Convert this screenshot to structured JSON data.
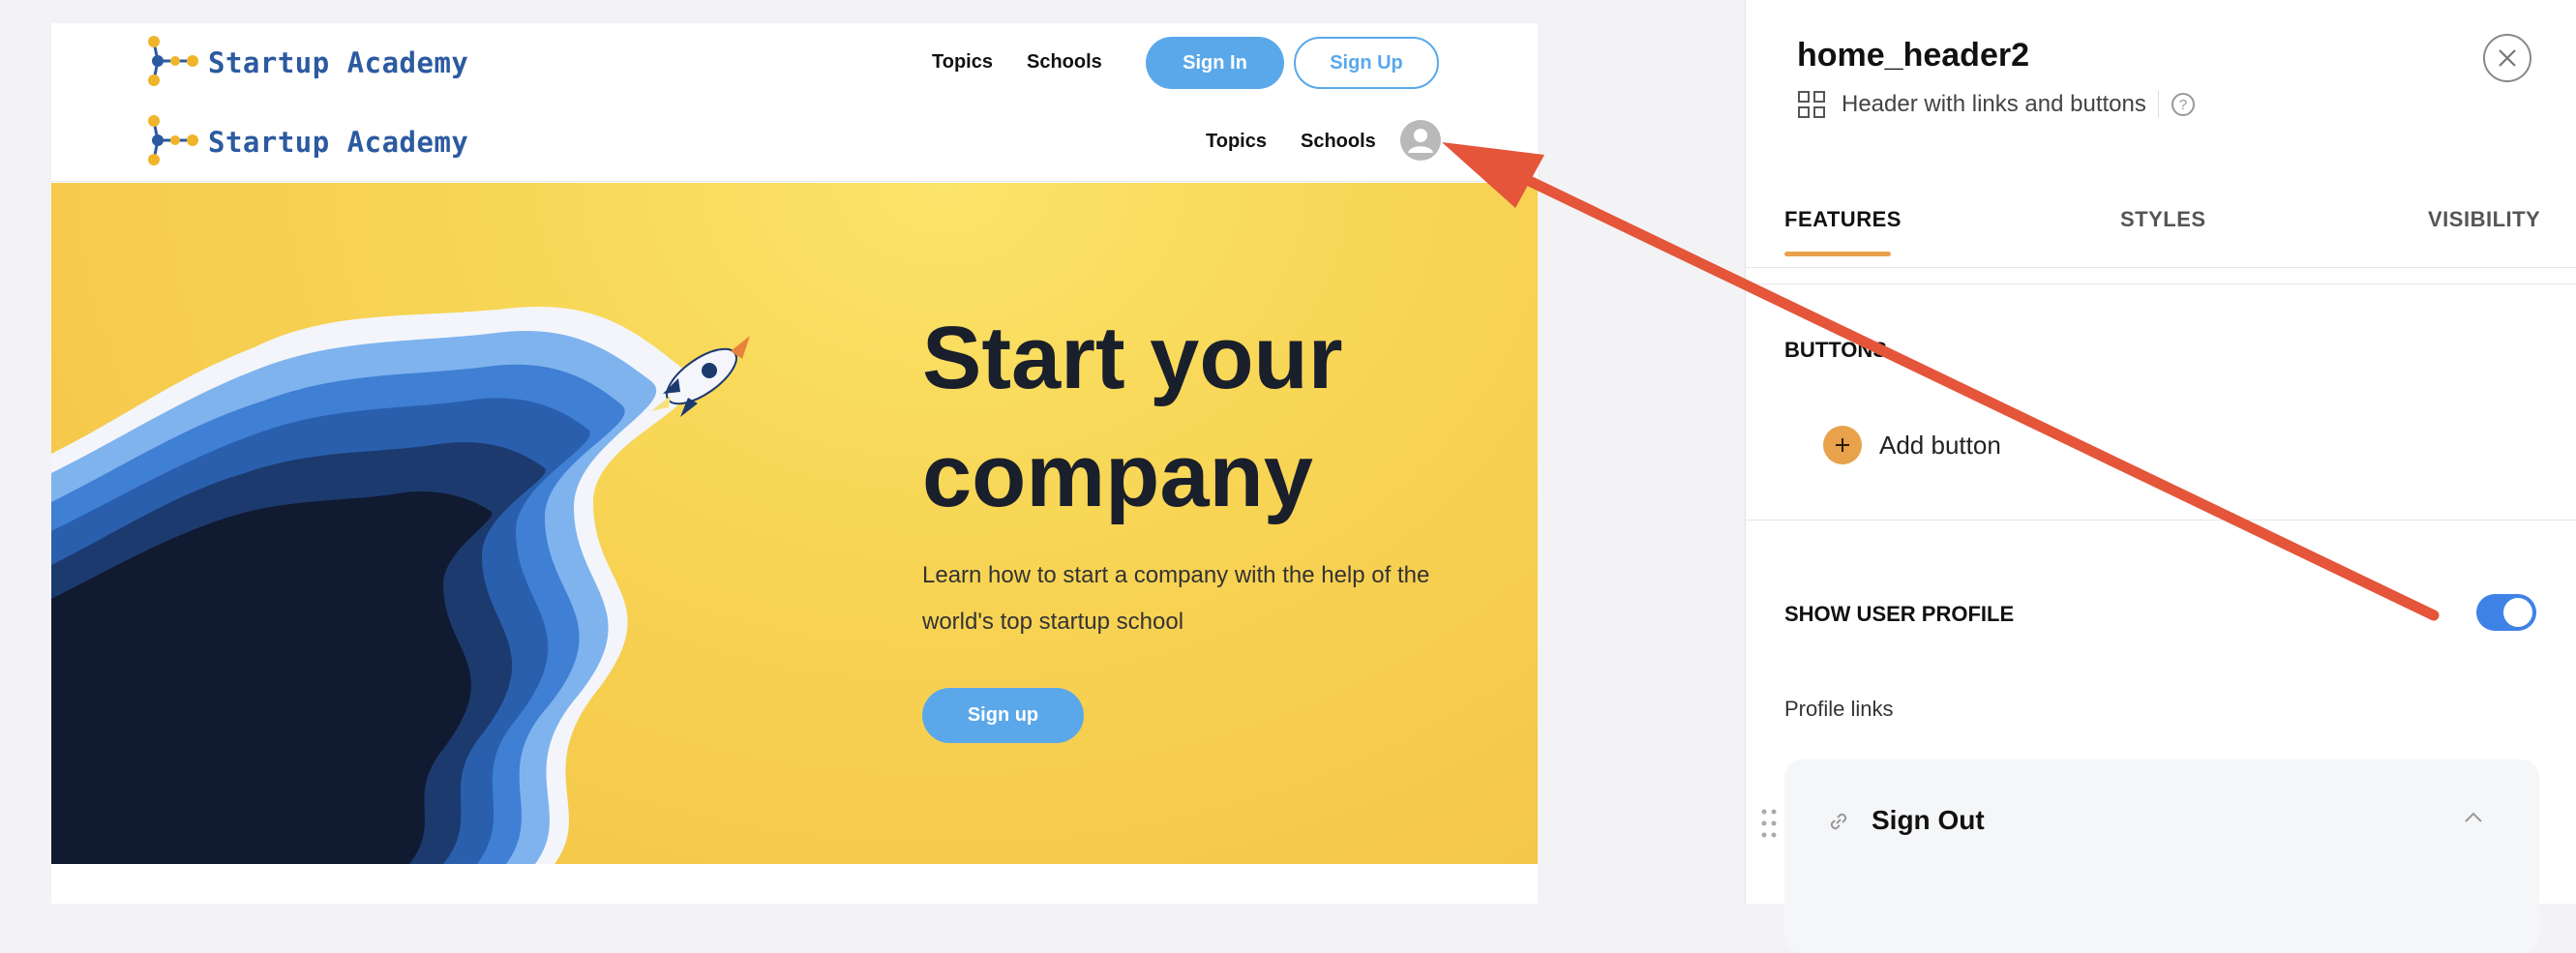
{
  "preview": {
    "brand": "Startup Academy",
    "header1": {
      "nav": [
        "Topics",
        "Schools"
      ],
      "signin_label": "Sign In",
      "signup_label": "Sign Up"
    },
    "header2": {
      "nav": [
        "Topics",
        "Schools"
      ]
    },
    "hero": {
      "title": "Start your company",
      "subtitle": "Learn how to start a company with the help of the world's top startup school",
      "button_label": "Sign up"
    }
  },
  "panel": {
    "title": "home_header2",
    "subtitle": "Header with links and buttons",
    "tabs": [
      "FEATURES",
      "STYLES",
      "VISIBILITY"
    ],
    "active_tab": "FEATURES",
    "buttons_section_label": "BUTTONS",
    "add_button_label": "Add button",
    "show_user_profile_label": "SHOW USER PROFILE",
    "show_user_profile_on": true,
    "profile_links_label": "Profile links",
    "link_card_title": "Sign Out"
  },
  "colors": {
    "accent_blue": "#5aa8ea",
    "toggle_blue": "#3f82e6",
    "accent_orange": "#e8a24b",
    "arrow_red": "#e4553a",
    "hero_yellow": "#f5c94c"
  },
  "icons": [
    "brand-logo-icon",
    "user-avatar-icon",
    "rocket-icon",
    "component-grid-icon",
    "help-icon",
    "close-icon",
    "plus-icon",
    "link-icon",
    "chevron-up-icon",
    "drag-handle-icon"
  ]
}
